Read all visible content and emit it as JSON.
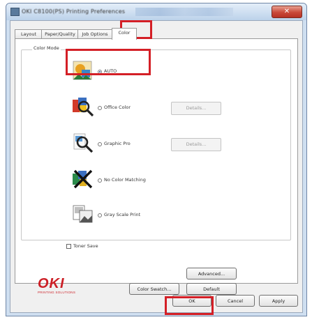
{
  "window": {
    "title": "OKI C8100(PS) Printing Preferences",
    "close_glyph": "✕"
  },
  "tabs": [
    {
      "label": "Layout"
    },
    {
      "label": "Paper/Quality"
    },
    {
      "label": "Job Options"
    },
    {
      "label": "Color",
      "active": true
    }
  ],
  "color_mode": {
    "group_label": "Color Mode",
    "options": [
      {
        "label": "AUTO",
        "selected": true,
        "has_details": false
      },
      {
        "label": "Office Color",
        "selected": false,
        "has_details": true
      },
      {
        "label": "Graphic Pro",
        "selected": false,
        "has_details": true
      },
      {
        "label": "No Color Matching",
        "selected": false,
        "has_details": false
      },
      {
        "label": "Gray Scale Print",
        "selected": false,
        "has_details": false
      }
    ],
    "details_label": "Details..."
  },
  "toner_save": {
    "label": "Toner Save",
    "checked": false
  },
  "buttons": {
    "advanced": "Advanced...",
    "color_swatch": "Color Swatch...",
    "default": "Default",
    "ok": "OK",
    "cancel": "Cancel",
    "apply": "Apply"
  },
  "logo": {
    "main": "OKI",
    "tagline": "PRINTING SOLUTIONS"
  },
  "colors": {
    "highlight": "#d41f26",
    "logo": "#cc1f26"
  }
}
